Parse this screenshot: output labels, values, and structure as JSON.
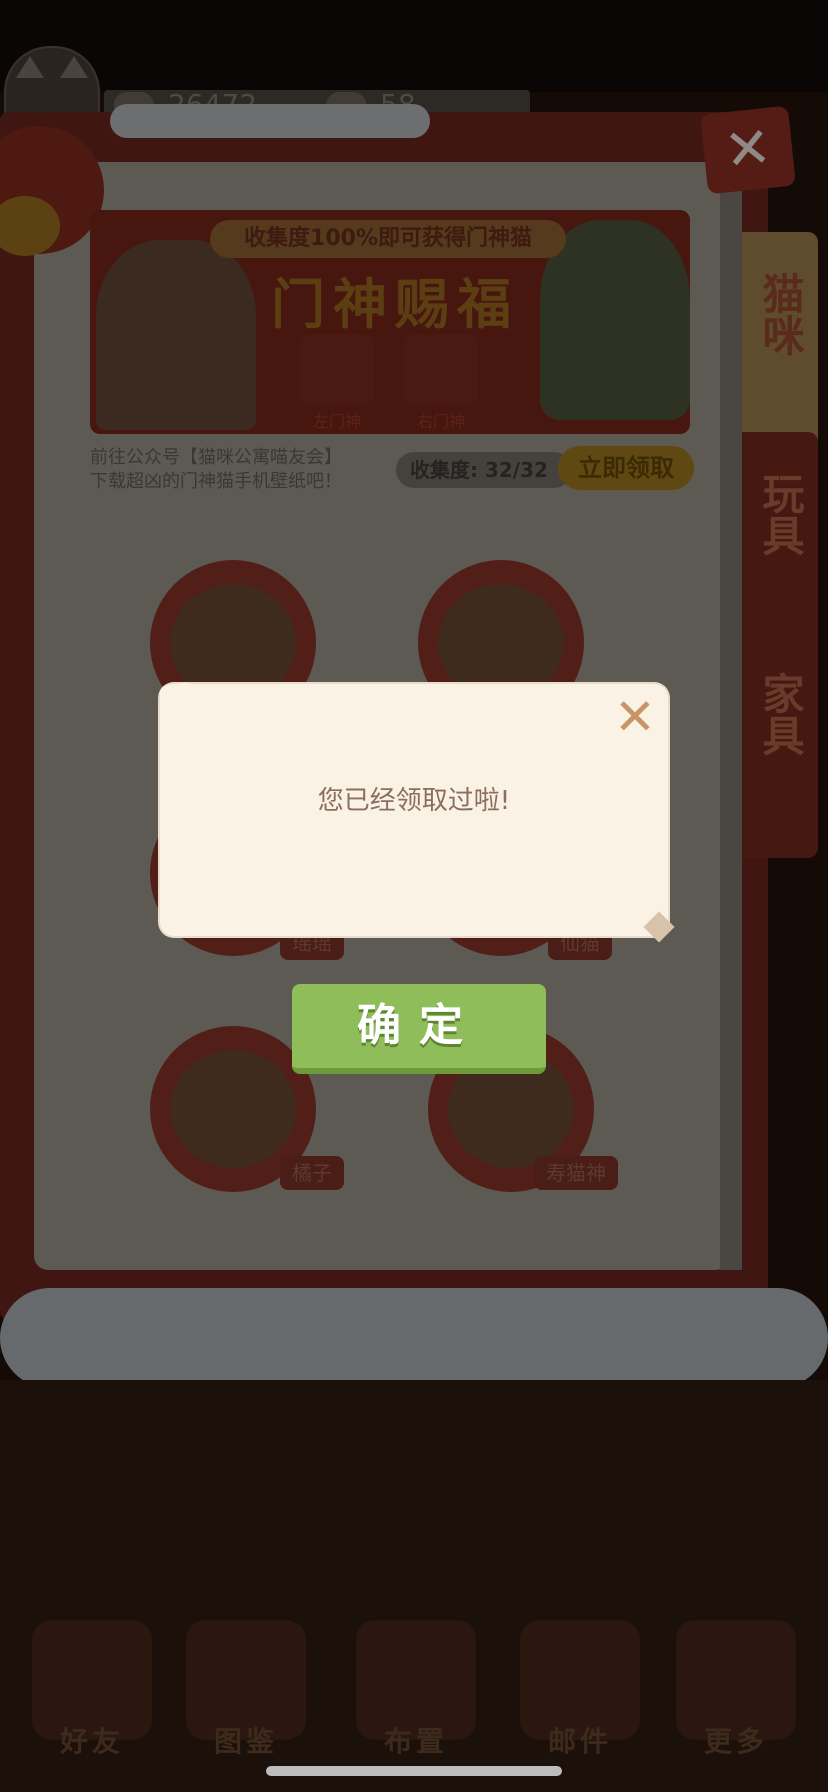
{
  "resources": {
    "coins": "26472",
    "fish": "58"
  },
  "side_tabs": [
    "猫咪",
    "玩具",
    "家具"
  ],
  "banner": {
    "ribbon": "收集度100%即可获得门神猫",
    "title": "门神赐福",
    "left_door": "左门神",
    "right_door": "右门神",
    "desc_line1": "前往公众号【猫咪公寓喵友会】",
    "desc_line2": "下载超凶的门神猫手机壁纸吧！",
    "progress": "收集度: 32/32",
    "claim_button": "立即领取"
  },
  "cats": [
    {
      "name": ""
    },
    {
      "name": ""
    },
    {
      "name": "瑶瑶"
    },
    {
      "name": "仙猫"
    },
    {
      "name": "橘子"
    },
    {
      "name": "寿猫神"
    }
  ],
  "modal": {
    "message": "您已经领取过啦!",
    "confirm": "确定",
    "close_glyph": "✕"
  },
  "bottom_nav": [
    "好友",
    "图鉴",
    "布置",
    "邮件",
    "更多"
  ],
  "colors": {
    "confirm_green": "#8fbd5a",
    "modal_bg": "#fbf2e6",
    "close_x": "#c99467"
  }
}
